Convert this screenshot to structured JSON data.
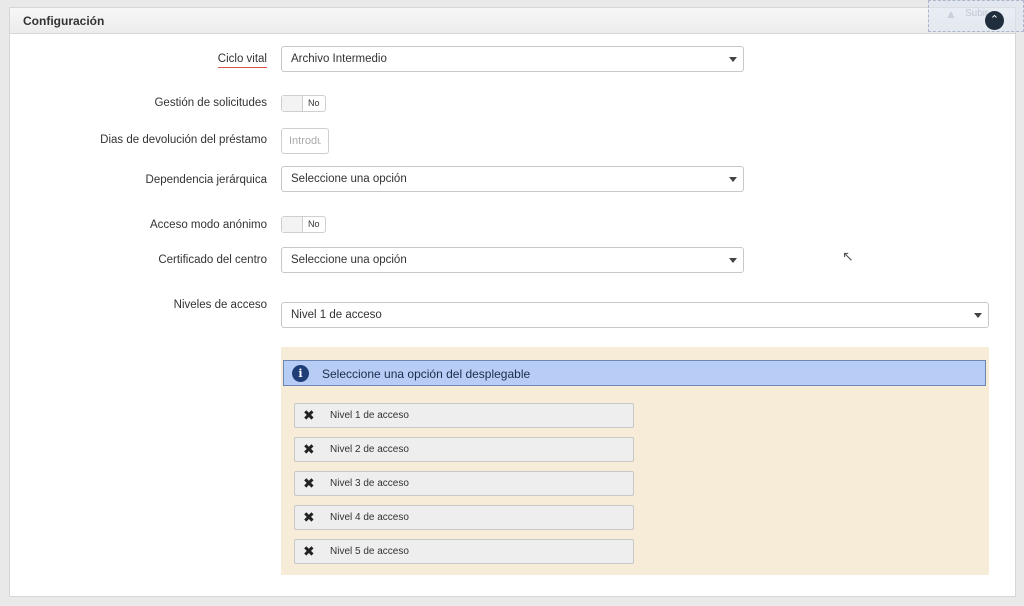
{
  "panel": {
    "title": "Configuración"
  },
  "scroll_top": {
    "label": "Subir"
  },
  "form": {
    "ciclo_vital": {
      "label": "Ciclo vital",
      "value": "Archivo Intermedio"
    },
    "gestion_solicitudes": {
      "label": "Gestión de solicitudes",
      "value": "No"
    },
    "dias_devolucion": {
      "label": "Dias de devolución del préstamo",
      "placeholder": "Introduzca"
    },
    "dependencia": {
      "label": "Dependencia jerárquica",
      "value": "Seleccione una opción"
    },
    "acceso_anonimo": {
      "label": "Acceso modo anónimo",
      "value": "No"
    },
    "certificado": {
      "label": "Certificado del centro",
      "value": "Seleccione una opción"
    },
    "niveles": {
      "label": "Niveles de acceso",
      "value": "Nivel 1 de acceso"
    }
  },
  "levels_info": "Seleccione una opción del desplegable",
  "levels": [
    {
      "label": "Nivel 1 de acceso"
    },
    {
      "label": "Nivel 2 de acceso"
    },
    {
      "label": "Nivel 3 de acceso"
    },
    {
      "label": "Nivel 4 de acceso"
    },
    {
      "label": "Nivel 5 de acceso"
    }
  ],
  "colors": {
    "info_bg": "#b7cdf5",
    "levels_bg": "#f6ecd8",
    "underline": "#d9534f"
  },
  "icons": [
    "chevron-up-icon",
    "caret-down-icon",
    "info-icon",
    "close-icon",
    "cursor-icon"
  ]
}
